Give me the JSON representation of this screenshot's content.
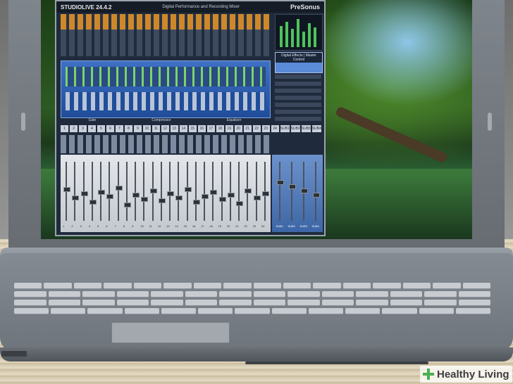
{
  "mixer": {
    "model": "STUDIOLIVE 24.4.2",
    "subtitle": "Digital Performance and Recording Mixer",
    "brand": "PreSonus",
    "lcd_title": "Digital Effects | Master Control",
    "section_labels": [
      "Gate",
      "Compressor",
      "Equalizer"
    ],
    "channel_numbers": [
      "1",
      "2",
      "3",
      "4",
      "5",
      "6",
      "7",
      "8",
      "9",
      "10",
      "11",
      "12",
      "13",
      "14",
      "15",
      "16",
      "17",
      "18",
      "19",
      "20",
      "21",
      "22",
      "23",
      "24",
      "SUB1",
      "SUB2",
      "SUB3",
      "SUB4"
    ],
    "subgroups": [
      "SUB1",
      "SUB2",
      "SUB3",
      "SUB4"
    ]
  },
  "watermark": {
    "text": "Healthy Living",
    "color": "#4caf50"
  }
}
